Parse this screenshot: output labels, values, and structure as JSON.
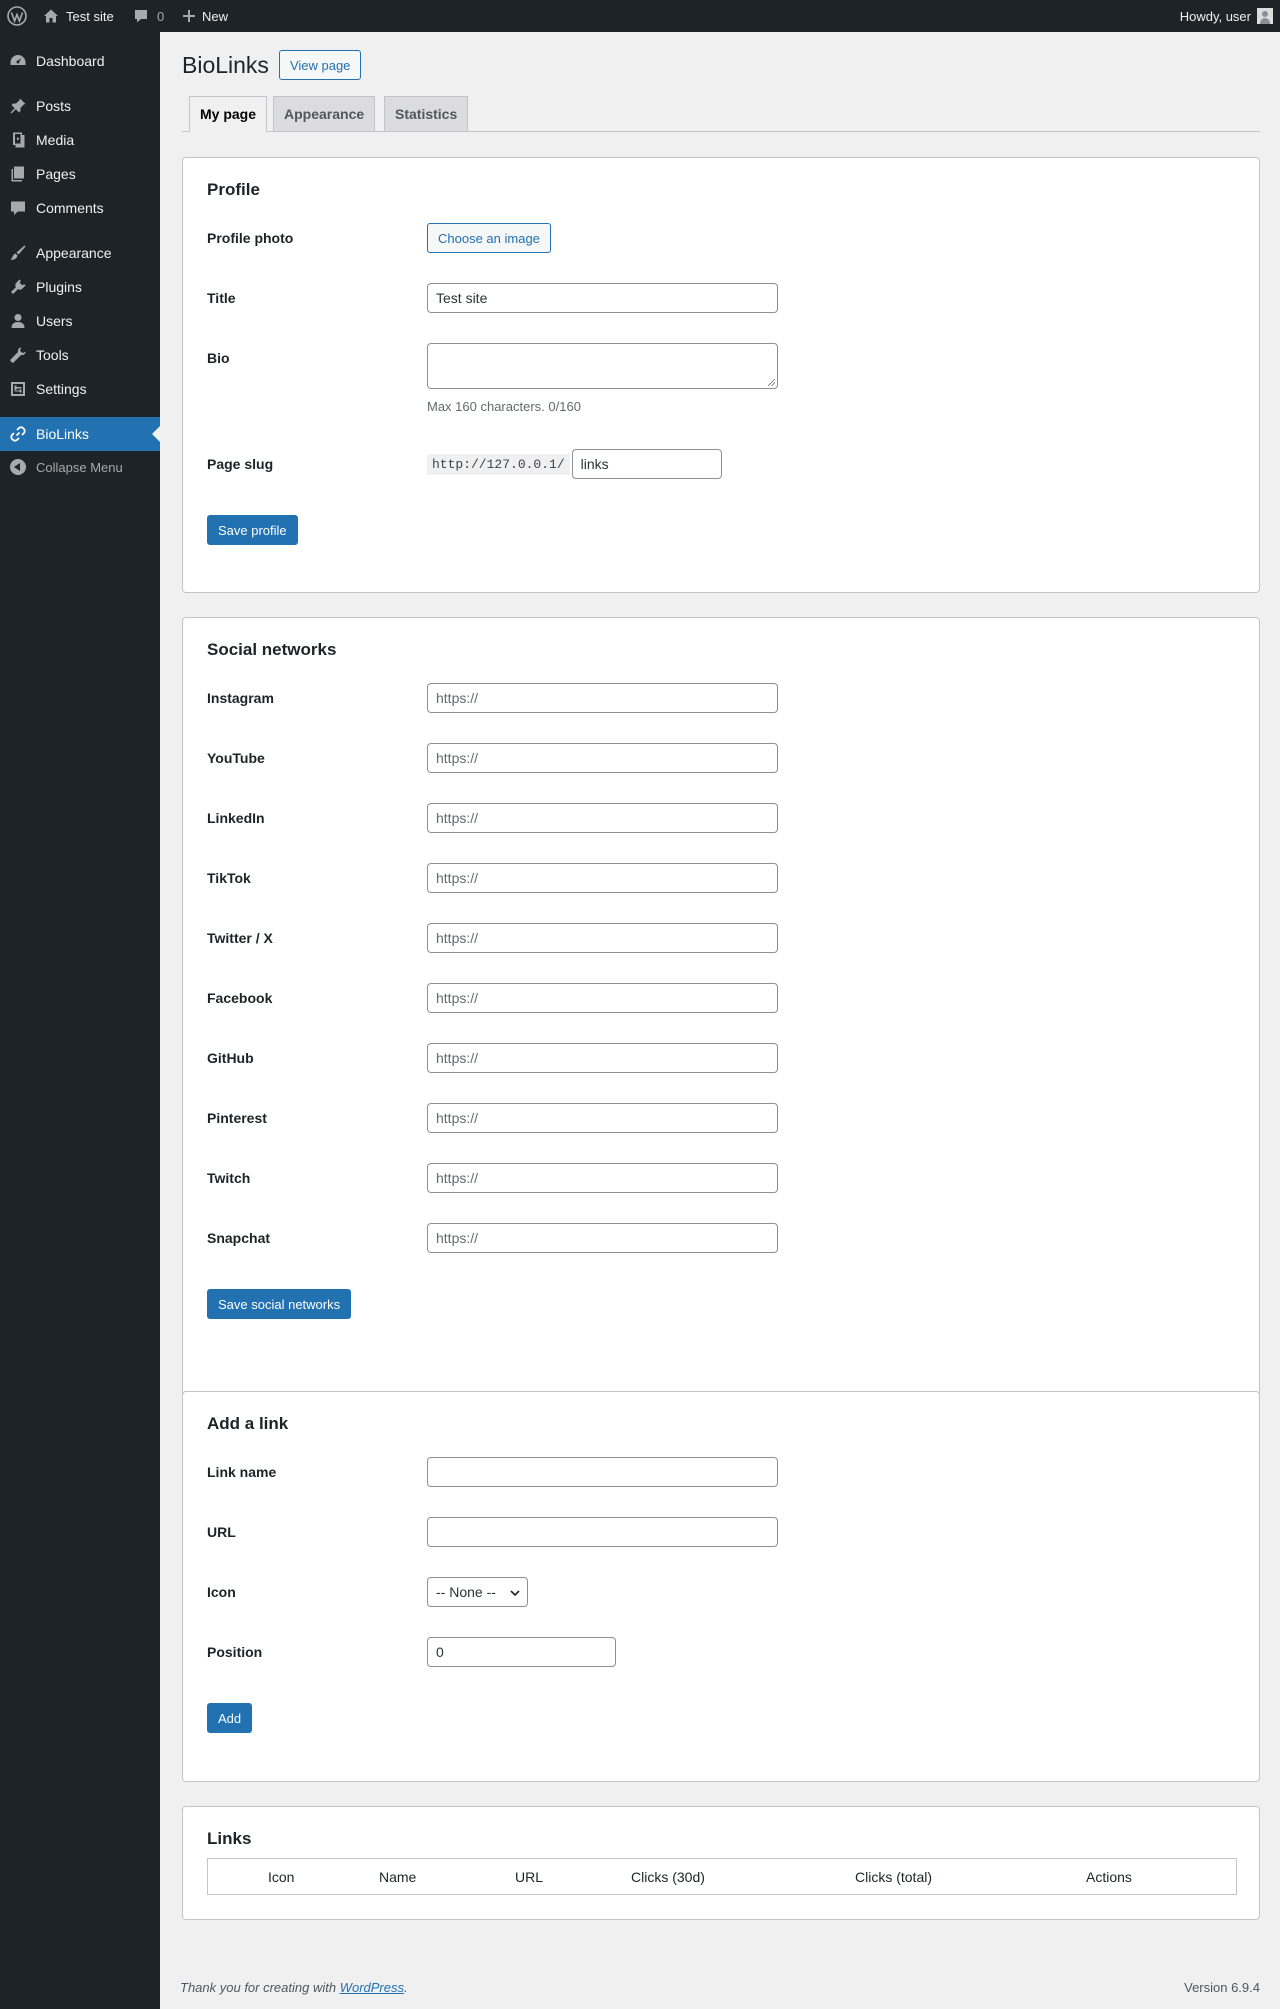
{
  "adminbar": {
    "site_name": "Test site",
    "comments_count": "0",
    "new_label": "New",
    "greeting": "Howdy, user"
  },
  "sidebar": {
    "items": [
      {
        "label": "Dashboard",
        "icon": "dashboard-icon"
      },
      {
        "label": "Posts",
        "icon": "pin-icon"
      },
      {
        "label": "Media",
        "icon": "media-icon"
      },
      {
        "label": "Pages",
        "icon": "pages-icon"
      },
      {
        "label": "Comments",
        "icon": "comment-icon"
      },
      {
        "label": "Appearance",
        "icon": "brush-icon"
      },
      {
        "label": "Plugins",
        "icon": "plug-icon"
      },
      {
        "label": "Users",
        "icon": "user-icon"
      },
      {
        "label": "Tools",
        "icon": "wrench-icon"
      },
      {
        "label": "Settings",
        "icon": "settings-icon"
      },
      {
        "label": "BioLinks",
        "icon": "link-icon",
        "current": true
      }
    ],
    "collapse_label": "Collapse Menu"
  },
  "page": {
    "title": "BioLinks",
    "view_page_label": "View page",
    "tabs": [
      {
        "label": "My page",
        "active": true
      },
      {
        "label": "Appearance",
        "active": false
      },
      {
        "label": "Statistics",
        "active": false
      }
    ]
  },
  "profile": {
    "heading": "Profile",
    "photo_label": "Profile photo",
    "choose_image_label": "Choose an image",
    "title_label": "Title",
    "title_value": "Test site",
    "bio_label": "Bio",
    "bio_value": "",
    "bio_hint": "Max 160 characters. 0/160",
    "slug_label": "Page slug",
    "slug_prefix": "http://127.0.0.1/",
    "slug_value": "links",
    "save_label": "Save profile"
  },
  "social": {
    "heading": "Social networks",
    "placeholder": "https://",
    "networks": [
      "Instagram",
      "YouTube",
      "LinkedIn",
      "TikTok",
      "Twitter / X",
      "Facebook",
      "GitHub",
      "Pinterest",
      "Twitch",
      "Snapchat"
    ],
    "save_label": "Save social networks"
  },
  "add_link": {
    "heading": "Add a link",
    "name_label": "Link name",
    "url_label": "URL",
    "icon_label": "Icon",
    "icon_selected": "-- None --",
    "position_label": "Position",
    "position_value": "0",
    "add_label": "Add"
  },
  "links": {
    "heading": "Links",
    "columns": [
      "",
      "Icon",
      "Name",
      "URL",
      "Clicks (30d)",
      "Clicks (total)",
      "Actions"
    ]
  },
  "footer": {
    "thanks_prefix": "Thank you for creating with ",
    "thanks_link": "WordPress",
    "thanks_suffix": ".",
    "version": "Version 6.9.4"
  }
}
